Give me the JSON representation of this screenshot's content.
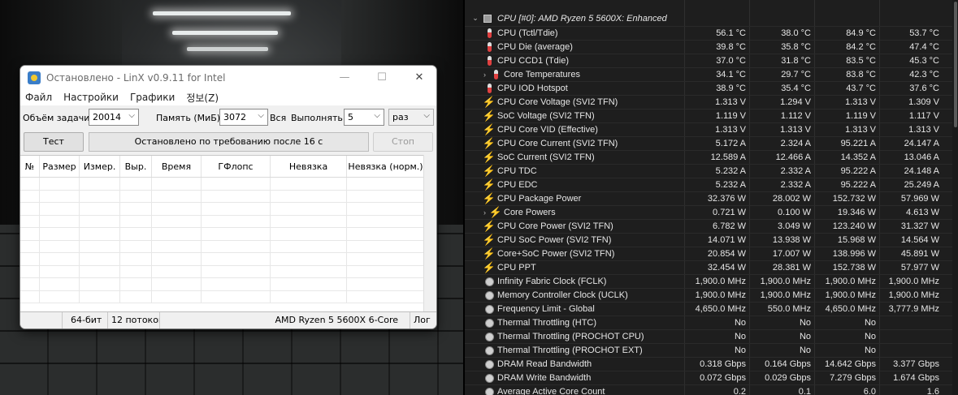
{
  "linx": {
    "title": "Остановлено - LinX v0.9.11 for Intel",
    "window_controls": {
      "minimize": "—",
      "maximize": "☐",
      "close": "✕"
    },
    "menu": [
      "Файл",
      "Настройки",
      "Графики",
      "정보(Z)"
    ],
    "params": {
      "size_label": "Объём задачи:",
      "size_value": "20014",
      "memory_label": "Память (МиБ):",
      "memory_value": "3072",
      "all_label": "Вся",
      "run_label": "Выполнять:",
      "run_value": "5",
      "unit_value": "раз"
    },
    "test_button": "Тест",
    "status": "Остановлено по требованию после 16 с",
    "stop_button": "Стоп",
    "columns": [
      "№",
      "Размер",
      "Измер.",
      "Выр.",
      "Время",
      "ГФлопс",
      "Невязка",
      "Невязка (норм.)"
    ],
    "statusbar": [
      "",
      "64-бит",
      "12 потоков",
      "AMD Ryzen 5 5600X 6-Core",
      "Лог"
    ]
  },
  "hwinfo": {
    "header": "CPU [#0]: AMD Ryzen 5 5600X: Enhanced",
    "rows": [
      {
        "name": "CPU (Tctl/Tdie)",
        "icon": "thermometer-icon",
        "cur": "56.1 °C",
        "min": "38.0 °C",
        "max": "84.9 °C",
        "avg": "53.7 °C"
      },
      {
        "name": "CPU Die (average)",
        "icon": "thermometer-icon",
        "cur": "39.8 °C",
        "min": "35.8 °C",
        "max": "84.2 °C",
        "avg": "47.4 °C"
      },
      {
        "name": "CPU CCD1 (Tdie)",
        "icon": "thermometer-icon",
        "cur": "37.0 °C",
        "min": "31.8 °C",
        "max": "83.5 °C",
        "avg": "45.3 °C"
      },
      {
        "name": "Core Temperatures",
        "icon": "thermometer-icon",
        "expand": true,
        "cur": "34.1 °C",
        "min": "29.7 °C",
        "max": "83.8 °C",
        "avg": "42.3 °C"
      },
      {
        "name": "CPU IOD Hotspot",
        "icon": "thermometer-icon",
        "cur": "38.9 °C",
        "min": "35.4 °C",
        "max": "43.7 °C",
        "avg": "37.6 °C"
      },
      {
        "name": "CPU Core Voltage (SVI2 TFN)",
        "icon": "bolt-icon",
        "cur": "1.313 V",
        "min": "1.294 V",
        "max": "1.313 V",
        "avg": "1.309 V"
      },
      {
        "name": "SoC Voltage (SVI2 TFN)",
        "icon": "bolt-icon",
        "cur": "1.119 V",
        "min": "1.112 V",
        "max": "1.119 V",
        "avg": "1.117 V"
      },
      {
        "name": "CPU Core VID (Effective)",
        "icon": "bolt-icon",
        "cur": "1.313 V",
        "min": "1.313 V",
        "max": "1.313 V",
        "avg": "1.313 V"
      },
      {
        "name": "CPU Core Current (SVI2 TFN)",
        "icon": "bolt-icon",
        "cur": "5.172 A",
        "min": "2.324 A",
        "max": "95.221 A",
        "avg": "24.147 A"
      },
      {
        "name": "SoC Current (SVI2 TFN)",
        "icon": "bolt-icon",
        "cur": "12.589 A",
        "min": "12.466 A",
        "max": "14.352 A",
        "avg": "13.046 A"
      },
      {
        "name": "CPU TDC",
        "icon": "bolt-icon",
        "cur": "5.232 A",
        "min": "2.332 A",
        "max": "95.222 A",
        "avg": "24.148 A"
      },
      {
        "name": "CPU EDC",
        "icon": "bolt-icon",
        "cur": "5.232 A",
        "min": "2.332 A",
        "max": "95.222 A",
        "avg": "25.249 A"
      },
      {
        "name": "CPU Package Power",
        "icon": "bolt-icon",
        "cur": "32.376 W",
        "min": "28.002 W",
        "max": "152.732 W",
        "avg": "57.969 W"
      },
      {
        "name": "Core Powers",
        "icon": "bolt-icon",
        "expand": true,
        "cur": "0.721 W",
        "min": "0.100 W",
        "max": "19.346 W",
        "avg": "4.613 W"
      },
      {
        "name": "CPU Core Power (SVI2 TFN)",
        "icon": "bolt-icon",
        "cur": "6.782 W",
        "min": "3.049 W",
        "max": "123.240 W",
        "avg": "31.327 W"
      },
      {
        "name": "CPU SoC Power (SVI2 TFN)",
        "icon": "bolt-icon",
        "cur": "14.071 W",
        "min": "13.938 W",
        "max": "15.968 W",
        "avg": "14.564 W"
      },
      {
        "name": "Core+SoC Power (SVI2 TFN)",
        "icon": "bolt-icon",
        "cur": "20.854 W",
        "min": "17.007 W",
        "max": "138.996 W",
        "avg": "45.891 W"
      },
      {
        "name": "CPU PPT",
        "icon": "bolt-icon",
        "cur": "32.454 W",
        "min": "28.381 W",
        "max": "152.738 W",
        "avg": "57.977 W"
      },
      {
        "name": "Infinity Fabric Clock (FCLK)",
        "icon": "clock-icon",
        "cur": "1,900.0 MHz",
        "min": "1,900.0 MHz",
        "max": "1,900.0 MHz",
        "avg": "1,900.0 MHz"
      },
      {
        "name": "Memory Controller Clock (UCLK)",
        "icon": "clock-icon",
        "cur": "1,900.0 MHz",
        "min": "1,900.0 MHz",
        "max": "1,900.0 MHz",
        "avg": "1,900.0 MHz"
      },
      {
        "name": "Frequency Limit - Global",
        "icon": "clock-icon",
        "cur": "4,650.0 MHz",
        "min": "550.0 MHz",
        "max": "4,650.0 MHz",
        "avg": "3,777.9 MHz"
      },
      {
        "name": "Thermal Throttling (HTC)",
        "icon": "clock-icon",
        "cur": "No",
        "min": "No",
        "max": "No",
        "avg": ""
      },
      {
        "name": "Thermal Throttling (PROCHOT CPU)",
        "icon": "clock-icon",
        "cur": "No",
        "min": "No",
        "max": "No",
        "avg": ""
      },
      {
        "name": "Thermal Throttling (PROCHOT EXT)",
        "icon": "clock-icon",
        "cur": "No",
        "min": "No",
        "max": "No",
        "avg": ""
      },
      {
        "name": "DRAM Read Bandwidth",
        "icon": "clock-icon",
        "cur": "0.318 Gbps",
        "min": "0.164 Gbps",
        "max": "14.642 Gbps",
        "avg": "3.377 Gbps"
      },
      {
        "name": "DRAM Write Bandwidth",
        "icon": "clock-icon",
        "cur": "0.072 Gbps",
        "min": "0.029 Gbps",
        "max": "7.279 Gbps",
        "avg": "1.674 Gbps"
      },
      {
        "name": "Average Active Core Count",
        "icon": "clock-icon",
        "cur": "0.2",
        "min": "0.1",
        "max": "6.0",
        "avg": "1.6"
      }
    ]
  }
}
